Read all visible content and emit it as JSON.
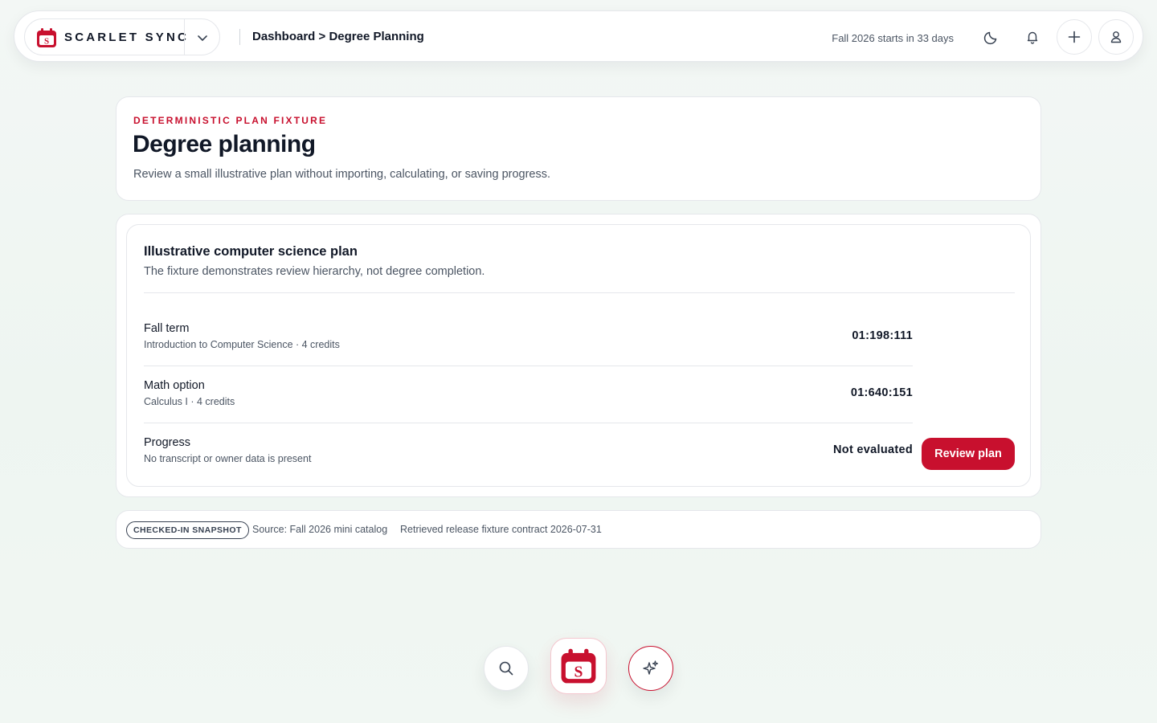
{
  "topbar": {
    "brand_name": "SCARLET SYNC",
    "breadcrumb": "Dashboard > Degree Planning",
    "countdown": "Fall 2026 starts in 33 days"
  },
  "header": {
    "eyebrow": "DETERMINISTIC PLAN FIXTURE",
    "title": "Degree planning",
    "subtitle": "Review a small illustrative plan without importing, calculating, or saving progress."
  },
  "plan": {
    "title": "Illustrative computer science plan",
    "subtitle": "The fixture demonstrates review hierarchy, not degree completion.",
    "rows": [
      {
        "title": "Fall term",
        "detail": "Introduction to Computer Science · 4 credits",
        "value": "01:198:111"
      },
      {
        "title": "Math option",
        "detail": "Calculus I · 4 credits",
        "value": "01:640:151"
      },
      {
        "title": "Progress",
        "detail": "No transcript or owner data is present",
        "value": "Not evaluated"
      }
    ],
    "action_label": "Review plan"
  },
  "source": {
    "badge": "CHECKED-IN SNAPSHOT",
    "source_text": "Source: Fall 2026 mini catalog",
    "retrieved_text": "Retrieved release fixture contract 2026-07-31"
  },
  "icons": {
    "logo": "calendar-s-logo-icon",
    "chevron": "chevron-down-icon",
    "theme": "moon-icon",
    "notifications": "bell-icon",
    "add": "plus-icon",
    "profile": "user-icon",
    "search": "search-icon",
    "assistant": "sparkles-icon"
  },
  "colors": {
    "accent": "#c8102e",
    "text": "#111827",
    "muted": "#4b5563"
  }
}
